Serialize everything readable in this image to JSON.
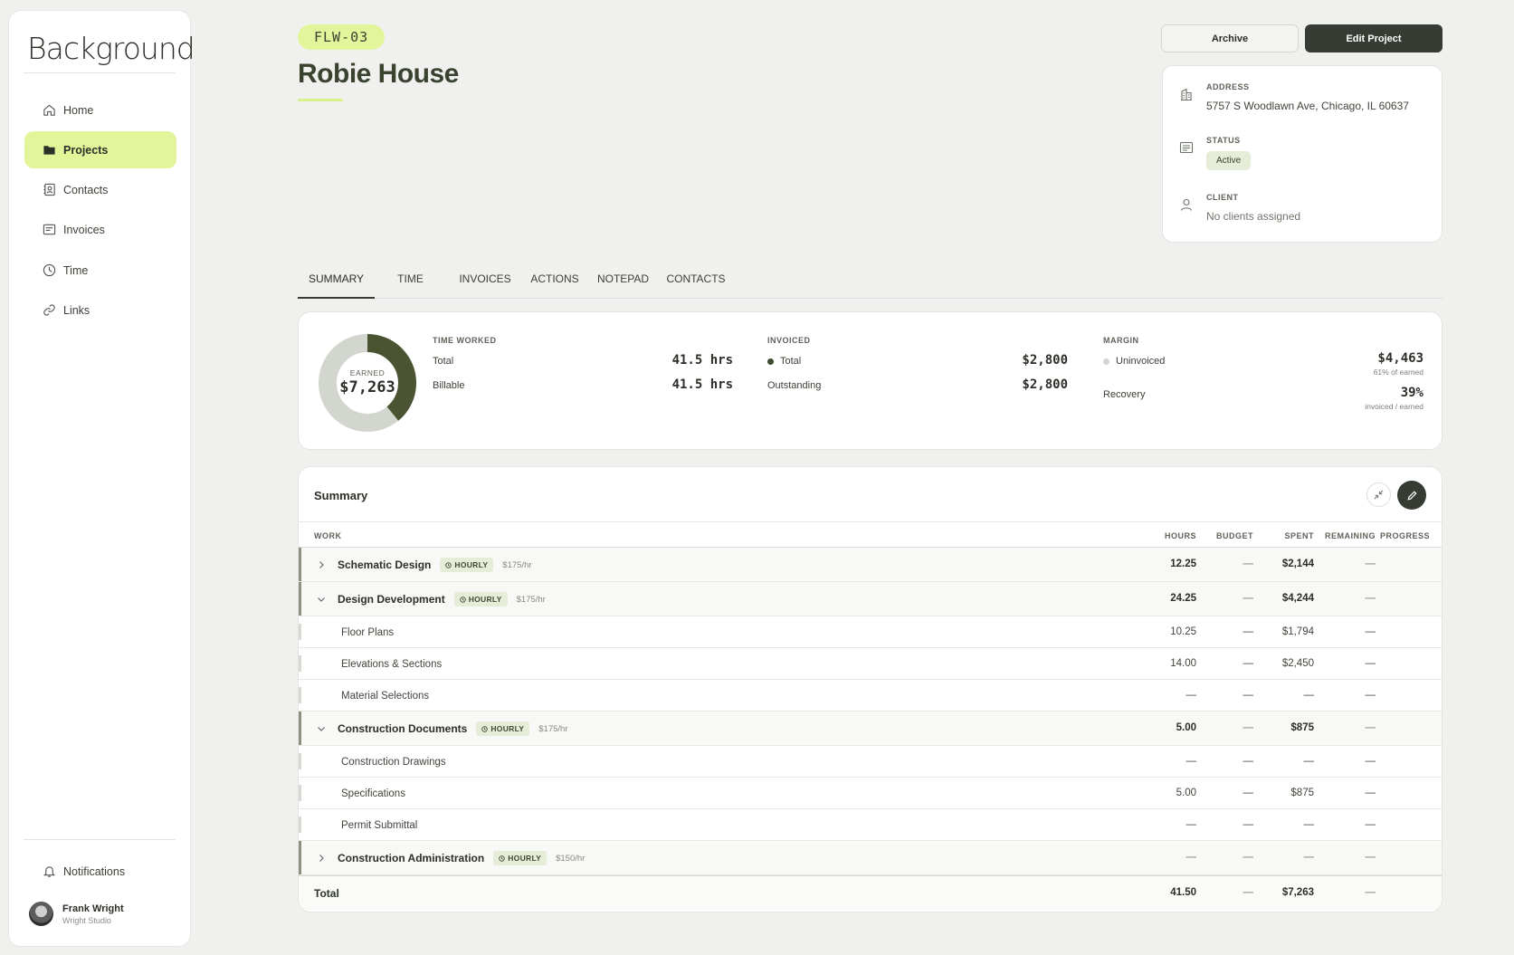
{
  "app": {
    "logo": "Background"
  },
  "sidebar": {
    "items": [
      {
        "label": "Home",
        "icon": "home-icon"
      },
      {
        "label": "Projects",
        "icon": "folder-icon"
      },
      {
        "label": "Contacts",
        "icon": "contacts-icon"
      },
      {
        "label": "Invoices",
        "icon": "invoice-icon"
      },
      {
        "label": "Time",
        "icon": "clock-icon"
      },
      {
        "label": "Links",
        "icon": "link-icon"
      }
    ],
    "notifications": "Notifications",
    "user": {
      "name": "Frank Wright",
      "org": "Wright Studio"
    }
  },
  "project": {
    "code": "FLW-03",
    "title": "Robie House",
    "archive_label": "Archive",
    "edit_label": "Edit Project",
    "info": {
      "address_label": "ADDRESS",
      "address": "5757 S Woodlawn Ave, Chicago, IL 60637",
      "status_label": "STATUS",
      "status": "Active",
      "client_label": "CLIENT",
      "client": "No clients assigned"
    }
  },
  "tabs": [
    "SUMMARY",
    "TIME",
    "INVOICES",
    "ACTIONS",
    "NOTEPAD",
    "CONTACTS"
  ],
  "stats": {
    "donut": {
      "label": "EARNED",
      "value": "$7,263",
      "invoiced_fraction": 0.39
    },
    "time": {
      "head": "TIME WORKED",
      "total_label": "Total",
      "total": "41.5 hrs",
      "billable_label": "Billable",
      "billable": "41.5 hrs"
    },
    "invoiced": {
      "head": "INVOICED",
      "total_label": "Total",
      "total": "$2,800",
      "outstanding_label": "Outstanding",
      "outstanding": "$2,800"
    },
    "margin": {
      "head": "MARGIN",
      "uninvoiced_label": "Uninvoiced",
      "uninvoiced": "$4,463",
      "uninvoiced_sub": "61% of earned",
      "recovery_label": "Recovery",
      "recovery": "39%",
      "recovery_sub": "invoiced / earned"
    }
  },
  "summary": {
    "title": "Summary",
    "headers": {
      "work": "WORK",
      "hours": "HOURS",
      "budget": "BUDGET",
      "spent": "SPENT",
      "remaining": "REMAINING",
      "progress": "PROGRESS"
    },
    "rows": [
      {
        "type": "group",
        "name": "Schematic Design",
        "tag": "HOURLY",
        "rate": "$175/hr",
        "expanded": false,
        "hours": "12.25",
        "budget": "—",
        "spent": "$2,144",
        "remaining": "—"
      },
      {
        "type": "group",
        "name": "Design Development",
        "tag": "HOURLY",
        "rate": "$175/hr",
        "expanded": true,
        "hours": "24.25",
        "budget": "—",
        "spent": "$4,244",
        "remaining": "—"
      },
      {
        "type": "sub",
        "name": "Floor Plans",
        "hours": "10.25",
        "budget": "—",
        "spent": "$1,794",
        "remaining": "—"
      },
      {
        "type": "sub",
        "name": "Elevations & Sections",
        "hours": "14.00",
        "budget": "—",
        "spent": "$2,450",
        "remaining": "—"
      },
      {
        "type": "sub",
        "name": "Material Selections",
        "hours": "—",
        "budget": "—",
        "spent": "—",
        "remaining": "—"
      },
      {
        "type": "group",
        "name": "Construction Documents",
        "tag": "HOURLY",
        "rate": "$175/hr",
        "expanded": true,
        "hours": "5.00",
        "budget": "—",
        "spent": "$875",
        "remaining": "—"
      },
      {
        "type": "sub",
        "name": "Construction Drawings",
        "hours": "—",
        "budget": "—",
        "spent": "—",
        "remaining": "—"
      },
      {
        "type": "sub",
        "name": "Specifications",
        "hours": "5.00",
        "budget": "—",
        "spent": "$875",
        "remaining": "—"
      },
      {
        "type": "sub",
        "name": "Permit Submittal",
        "hours": "—",
        "budget": "—",
        "spent": "—",
        "remaining": "—"
      },
      {
        "type": "group",
        "name": "Construction Administration",
        "tag": "HOURLY",
        "rate": "$150/hr",
        "expanded": false,
        "hours": "—",
        "budget": "—",
        "spent": "—",
        "remaining": "—"
      }
    ],
    "total": {
      "label": "Total",
      "hours": "41.50",
      "budget": "—",
      "spent": "$7,263",
      "remaining": "—"
    }
  },
  "colors": {
    "accent": "#e3f59b",
    "dark": "#363c34",
    "donut_fill": "#4a5433",
    "donut_track": "#d3d6cf"
  }
}
